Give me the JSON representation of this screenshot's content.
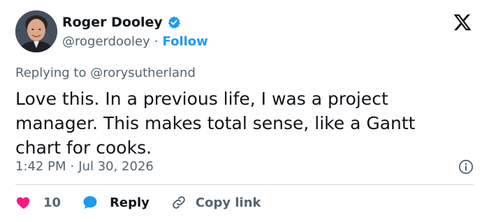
{
  "author": {
    "name": "Roger Dooley",
    "handle": "@rogerdooley",
    "separator": "·",
    "follow_label": "Follow"
  },
  "replying": {
    "prefix": "Replying to",
    "mention": "@rorysutherland"
  },
  "tweet": {
    "text": "Love this. In a previous life, I was a project manager. This makes total sense, like a Gantt chart for cooks."
  },
  "meta": {
    "time": "1:42 PM",
    "separator": "·",
    "date": "Jul 30, 2026"
  },
  "actions": {
    "like_count": "10",
    "reply_label": "Reply",
    "copy_link_label": "Copy link"
  },
  "colors": {
    "accent": "#1d9bf0",
    "like": "#f91880",
    "text": "#0f1419",
    "muted": "#536471"
  },
  "icons": [
    "verified-badge-icon",
    "x-logo-icon",
    "info-icon",
    "heart-icon",
    "reply-bubble-icon",
    "link-icon"
  ]
}
